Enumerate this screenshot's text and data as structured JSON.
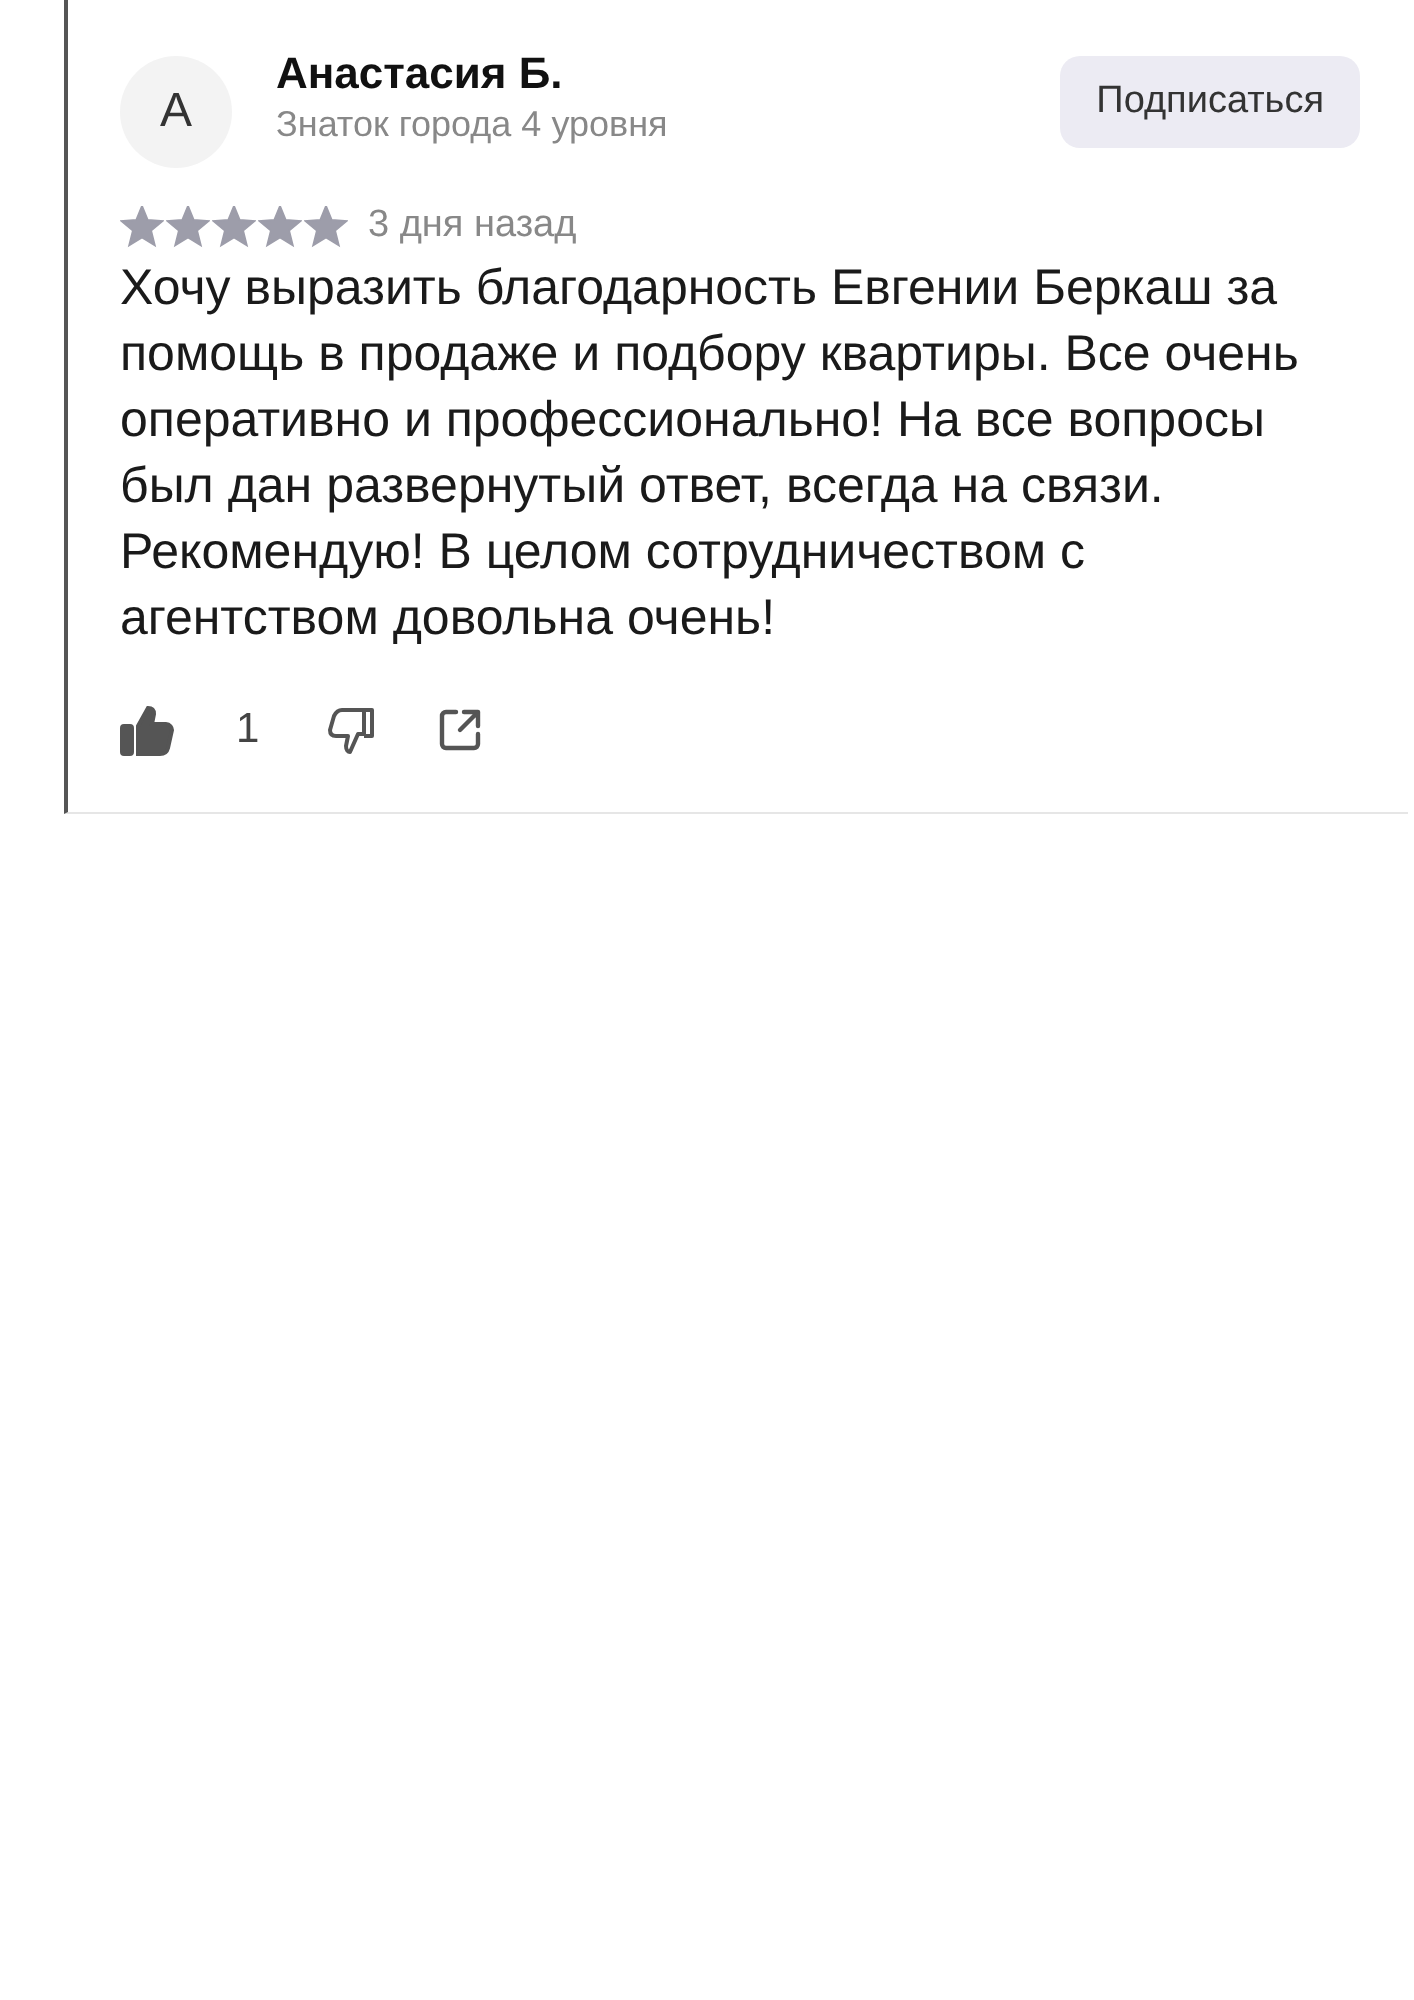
{
  "review": {
    "avatar_letter": "А",
    "author": "Анастасия Б.",
    "author_status": "Знаток города 4 уровня",
    "subscribe_button": "Подписаться",
    "stars": 5,
    "date": "3 дня назад",
    "text": "Хочу выразить благодарность Евгении Беркаш за помощь в продаже и подбору квартиры. Все очень оперативно и профессионально! На все вопросы был дан развернутый ответ, всегда на связи. Рекомендую! В целом сотрудничеством с агентством довольна очень!",
    "likes": {
      "liked": true,
      "count": "1"
    }
  }
}
